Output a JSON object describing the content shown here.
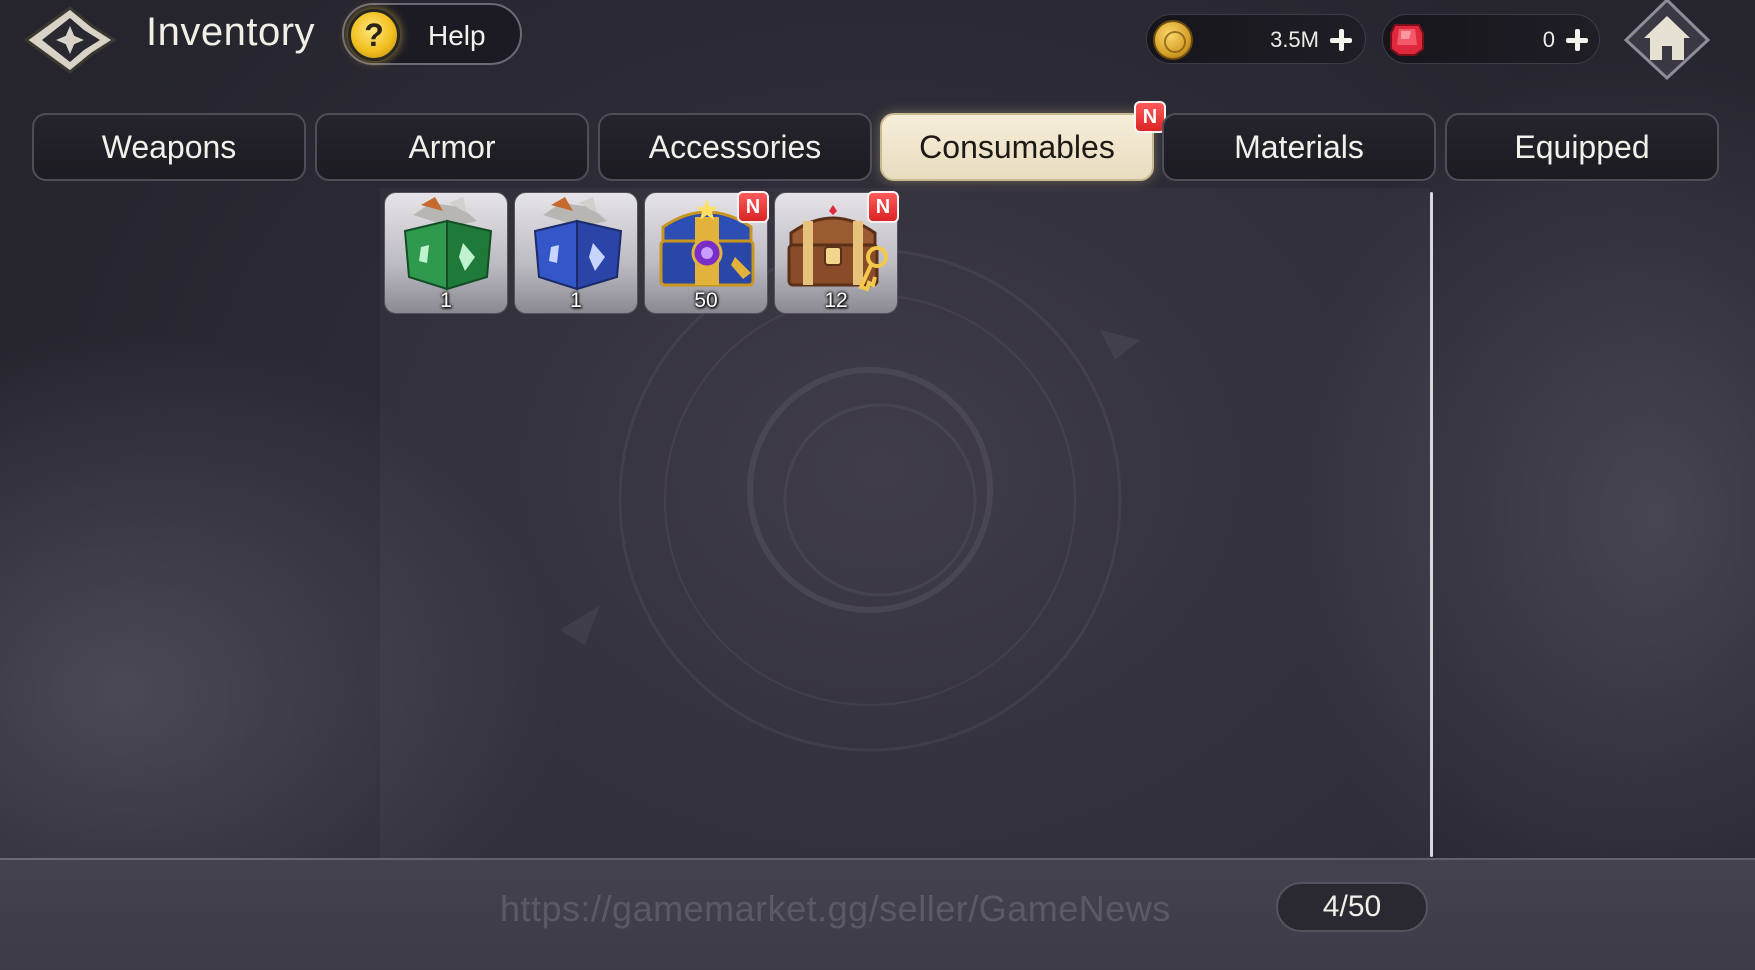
{
  "header": {
    "title": "Inventory",
    "help_icon_glyph": "?",
    "help_label": "Help",
    "back_icon": "ornate-back-arrow-icon",
    "home_icon": "house-icon"
  },
  "currencies": [
    {
      "name": "gold",
      "icon": "gold-coin-icon",
      "value": "3.5M"
    },
    {
      "name": "gem",
      "icon": "red-gem-icon",
      "value": "0"
    }
  ],
  "tabs": [
    {
      "label": "Weapons",
      "active": false,
      "new": false
    },
    {
      "label": "Armor",
      "active": false,
      "new": false
    },
    {
      "label": "Accessories",
      "active": false,
      "new": false
    },
    {
      "label": "Consumables",
      "active": true,
      "new": true
    },
    {
      "label": "Materials",
      "active": false,
      "new": false
    },
    {
      "label": "Equipped",
      "active": false,
      "new": false
    }
  ],
  "new_badge_text": "N",
  "items": [
    {
      "icon": "green-equipment-box-icon",
      "quantity": "1",
      "new": false
    },
    {
      "icon": "blue-equipment-box-icon",
      "quantity": "1",
      "new": false
    },
    {
      "icon": "purple-gold-treasure-chest-icon",
      "quantity": "50",
      "new": true
    },
    {
      "icon": "wooden-treasure-chest-with-key-icon",
      "quantity": "12",
      "new": true
    }
  ],
  "footer": {
    "watermark": "https://gamemarket.gg/seller/GameNews",
    "inventory_count": "4/50"
  },
  "colors": {
    "active_tab_bg": "#f7eed9",
    "tab_bg": "#1f1e25",
    "badge_red": "#e53030",
    "gold": "#e0a92f",
    "gem_red": "#e0283c"
  }
}
